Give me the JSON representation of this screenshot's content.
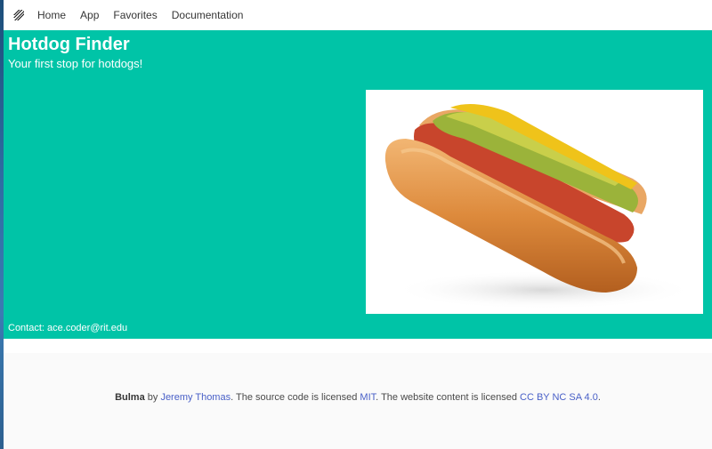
{
  "navbar": {
    "brand_icon": "bulma-logo-icon",
    "items": [
      {
        "label": "Home"
      },
      {
        "label": "App"
      },
      {
        "label": "Favorites"
      },
      {
        "label": "Documentation"
      }
    ]
  },
  "hero": {
    "title": "Hotdog Finder",
    "subtitle": "Your first stop for hotdogs!",
    "image": "hotdog-photo",
    "contact": "Contact: ace.coder@rit.edu",
    "background_color": "#00c4a7"
  },
  "footer": {
    "brand": "Bulma",
    "by": " by ",
    "author": "Jeremy Thomas",
    "source_text": ". The source code is licensed ",
    "source_license": "MIT",
    "content_text": ". The website content is licensed ",
    "content_license": "CC BY NC SA 4.0",
    "end": ".",
    "link_color": "#485fc7"
  }
}
